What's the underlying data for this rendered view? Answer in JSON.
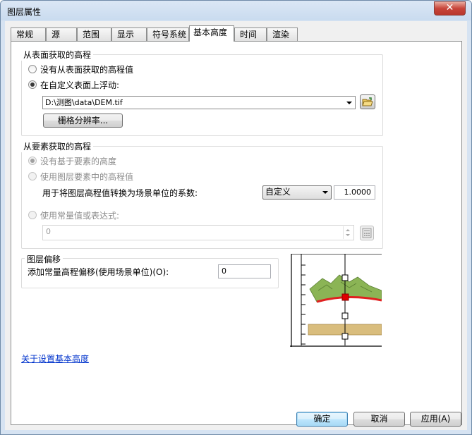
{
  "window": {
    "title": "图层属性",
    "close_symbol": "✕"
  },
  "tabs": [
    {
      "label": "常规",
      "active": false
    },
    {
      "label": "源",
      "active": false
    },
    {
      "label": "范围",
      "active": false
    },
    {
      "label": "显示",
      "active": false
    },
    {
      "label": "符号系统",
      "active": false
    },
    {
      "label": "基本高度",
      "active": true
    },
    {
      "label": "时间",
      "active": false
    },
    {
      "label": "渲染",
      "active": false
    }
  ],
  "surface_group": {
    "title": "从表面获取的高程",
    "option_none": "没有从表面获取的高程值",
    "option_float": "在自定义表面上浮动:",
    "surface_path": "D:\\测图\\data\\DEM.tif",
    "raster_resolution_button": "栅格分辨率..."
  },
  "feature_group": {
    "title": "从要素获取的高程",
    "option_none": "没有基于要素的高度",
    "option_use_values": "使用图层要素中的高程值",
    "conversion_label": "用于将图层高程值转换为场景单位的系数:",
    "conversion_unit": "自定义",
    "conversion_factor": "1.0000",
    "option_expression": "使用常量值或表达式:",
    "expression_value": "0"
  },
  "offset_group": {
    "title": "图层偏移",
    "label": "添加常量高程偏移(使用场景单位)(O):",
    "value": "0"
  },
  "help_link": "关于设置基本高度",
  "buttons": {
    "ok": "确定",
    "cancel": "取消",
    "apply": "应用(A)"
  },
  "colors": {
    "surface_edge": "#e02020",
    "terrain": "#8bb455",
    "plane": "#d9bd7d",
    "marker": "#e00000"
  },
  "icons": [
    "open-folder-icon",
    "calculator-icon",
    "elevation-diagram"
  ]
}
